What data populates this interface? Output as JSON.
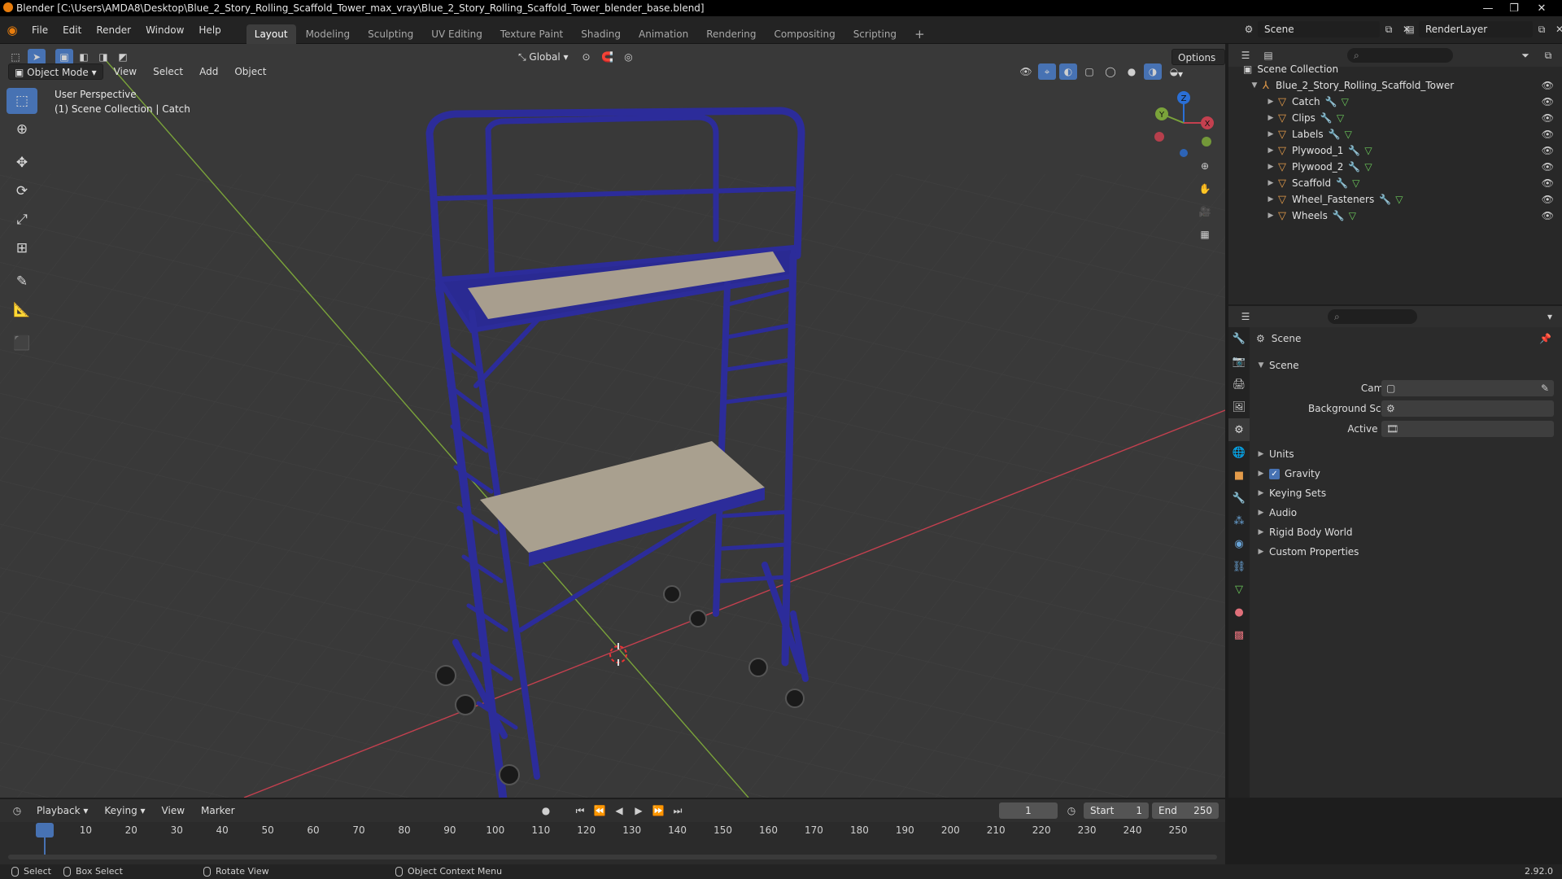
{
  "window": {
    "title": "Blender [C:\\Users\\AMDA8\\Desktop\\Blue_2_Story_Rolling_Scaffold_Tower_max_vray\\Blue_2_Story_Rolling_Scaffold_Tower_blender_base.blend]",
    "minimize": "—",
    "maximize": "❐",
    "close": "✕"
  },
  "menu": [
    "File",
    "Edit",
    "Render",
    "Window",
    "Help"
  ],
  "workspaces": [
    "Layout",
    "Modeling",
    "Sculpting",
    "UV Editing",
    "Texture Paint",
    "Shading",
    "Animation",
    "Rendering",
    "Compositing",
    "Scripting"
  ],
  "workspace_add": "+",
  "scene_selector": "Scene",
  "render_layer": "RenderLayer",
  "viewport": {
    "mode": "Object Mode",
    "menus": [
      "View",
      "Select",
      "Add",
      "Object"
    ],
    "orientation": "Global",
    "options": "Options",
    "perspective_label": "User Perspective",
    "collection_label": "(1) Scene Collection | Catch",
    "gizmo_axes": {
      "x": "X",
      "y": "Y",
      "z": "Z"
    }
  },
  "outliner": {
    "root": "Scene Collection",
    "collection": "Blue_2_Story_Rolling_Scaffold_Tower",
    "objects": [
      "Catch",
      "Clips",
      "Labels",
      "Plywood_1",
      "Plywood_2",
      "Scaffold",
      "Wheel_Fasteners",
      "Wheels"
    ]
  },
  "properties": {
    "context": "Scene",
    "section": "Scene",
    "fields": [
      {
        "label": "Camera",
        "value": ""
      },
      {
        "label": "Background Scene",
        "value": ""
      },
      {
        "label": "Active Clip",
        "value": ""
      }
    ],
    "panels": [
      {
        "label": "Units",
        "checkbox": false
      },
      {
        "label": "Gravity",
        "checkbox": true
      },
      {
        "label": "Keying Sets",
        "checkbox": false
      },
      {
        "label": "Audio",
        "checkbox": false
      },
      {
        "label": "Rigid Body World",
        "checkbox": false
      },
      {
        "label": "Custom Properties",
        "checkbox": false
      }
    ]
  },
  "timeline": {
    "menus": [
      "Playback",
      "Keying",
      "View",
      "Marker"
    ],
    "current_frame": "1",
    "start_label": "Start",
    "start": "1",
    "end_label": "End",
    "end": "250",
    "ruler": [
      "1",
      "10",
      "20",
      "30",
      "40",
      "50",
      "60",
      "70",
      "80",
      "90",
      "100",
      "110",
      "120",
      "130",
      "140",
      "150",
      "160",
      "170",
      "180",
      "190",
      "200",
      "210",
      "220",
      "230",
      "240",
      "250"
    ]
  },
  "statusbar": {
    "select": "Select",
    "box_select": "Box Select",
    "rotate_view": "Rotate View",
    "context_menu": "Object Context Menu",
    "version": "2.92.0"
  },
  "colors": {
    "accent": "#4772b3",
    "scaffold": "#2c2c9a",
    "object_icon": "#e39b4a",
    "mesh_icon": "#6cca5b",
    "x_axis": "#c4404f",
    "y_axis": "#7aa33a"
  }
}
